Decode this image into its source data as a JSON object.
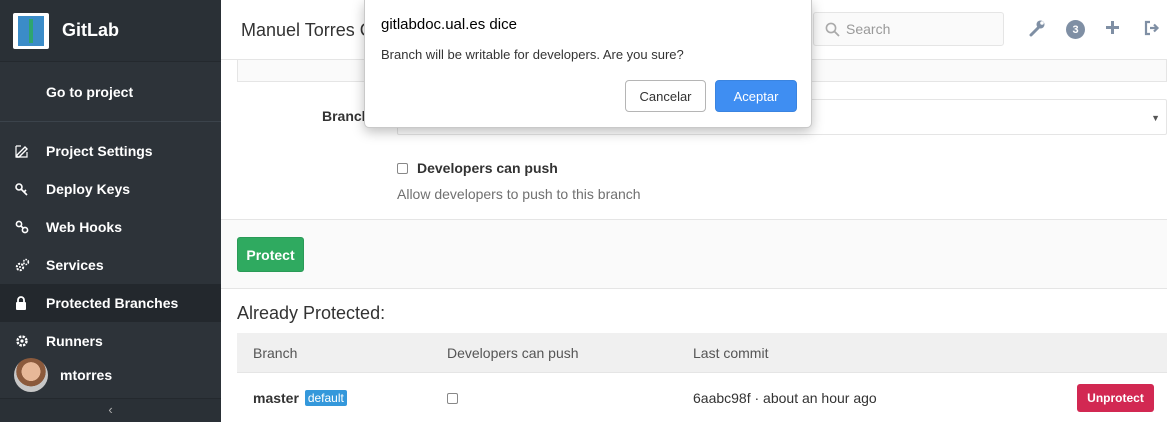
{
  "sidebar": {
    "app_title": "GitLab",
    "goto_label": "Go to project",
    "items": [
      {
        "label": "Project Settings",
        "icon": "edit-icon"
      },
      {
        "label": "Deploy Keys",
        "icon": "key-icon"
      },
      {
        "label": "Web Hooks",
        "icon": "link-icon"
      },
      {
        "label": "Services",
        "icon": "cogs-icon"
      },
      {
        "label": "Protected Branches",
        "icon": "lock-icon",
        "active": true
      },
      {
        "label": "Runners",
        "icon": "gear-icon"
      }
    ],
    "username": "mtorres",
    "collapse_glyph": "‹"
  },
  "header": {
    "title": "Manuel Torres G",
    "search_placeholder": "Search",
    "notification_count": "3"
  },
  "form": {
    "branch_label": "Branch",
    "checkbox_label": "Developers can push",
    "help_text": "Allow developers to push to this branch",
    "protect_button": "Protect"
  },
  "protected": {
    "title": "Already Protected:",
    "columns": [
      "Branch",
      "Developers can push",
      "Last commit"
    ],
    "rows": [
      {
        "branch": "master",
        "badge": "default",
        "developers_can_push": false,
        "last_commit": "6aabc98f · about an hour ago",
        "action": "Unprotect"
      }
    ]
  },
  "dialog": {
    "title": "gitlabdoc.ual.es dice",
    "message": "Branch will be writable for developers. Are you sure?",
    "cancel": "Cancelar",
    "accept": "Aceptar"
  },
  "colors": {
    "sidebar_bg": "#2d3339",
    "protect_green": "#2faa60",
    "unprotect_red": "#d22852",
    "accept_blue": "#3f8ef2",
    "badge_blue": "#3498db"
  }
}
